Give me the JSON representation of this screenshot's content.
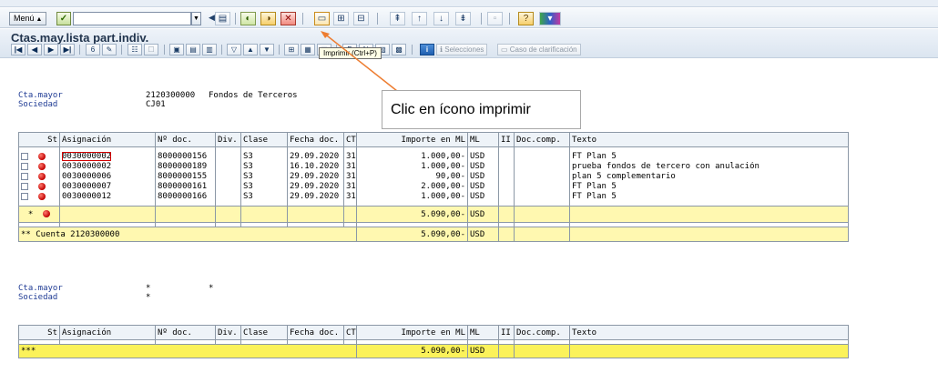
{
  "toolbar": {
    "menu_label": "Menú",
    "icons": [
      "back-icon",
      "exit-icon",
      "cancel-icon",
      "print-icon",
      "find-icon",
      "find-next-icon",
      "first-page-icon",
      "previous-page-icon",
      "next-page-icon",
      "last-page-icon",
      "new-session-icon",
      "help-icon",
      "layout-icon"
    ]
  },
  "title": "Ctas.may.lista part.indiv.",
  "app_toolbar": {
    "selecciones_label": "Selecciones",
    "caso_label": "Caso de clarificación"
  },
  "tooltip": "Imprimir (Ctrl+P)",
  "annotation": "Clic en ícono imprimir",
  "block1": {
    "cta_mayor_label": "Cta.mayor",
    "cta_mayor_value": "2120300000",
    "cta_mayor_text": "Fondos de Terceros",
    "sociedad_label": "Sociedad",
    "sociedad_value": "CJ01"
  },
  "table_headers": [
    "St",
    "Asignación",
    "Nº doc.",
    "Div.",
    "Clase",
    "Fecha doc.",
    "CT",
    "Importe en ML",
    "ML",
    "II",
    "Doc.comp.",
    "Texto"
  ],
  "rows": [
    {
      "asignacion": "0030000002",
      "nodoc": "8000000156",
      "div": "",
      "clase": "S3",
      "fecha": "29.09.2020",
      "ct": "31",
      "importe": "1.000,00-",
      "ml": "USD",
      "ii": "",
      "doccomp": "",
      "texto": "FT Plan 5"
    },
    {
      "asignacion": "0030000002",
      "nodoc": "8000000189",
      "div": "",
      "clase": "S3",
      "fecha": "16.10.2020",
      "ct": "31",
      "importe": "1.000,00-",
      "ml": "USD",
      "ii": "",
      "doccomp": "",
      "texto": "prueba fondos de tercero con anulación"
    },
    {
      "asignacion": "0030000006",
      "nodoc": "8000000155",
      "div": "",
      "clase": "S3",
      "fecha": "29.09.2020",
      "ct": "31",
      "importe": "90,00-",
      "ml": "USD",
      "ii": "",
      "doccomp": "",
      "texto": "plan 5 complementario"
    },
    {
      "asignacion": "0030000007",
      "nodoc": "8000000161",
      "div": "",
      "clase": "S3",
      "fecha": "29.09.2020",
      "ct": "31",
      "importe": "2.000,00-",
      "ml": "USD",
      "ii": "",
      "doccomp": "",
      "texto": "FT Plan 5"
    },
    {
      "asignacion": "0030000012",
      "nodoc": "8000000166",
      "div": "",
      "clase": "S3",
      "fecha": "29.09.2020",
      "ct": "31",
      "importe": "1.000,00-",
      "ml": "USD",
      "ii": "",
      "doccomp": "",
      "texto": "FT Plan 5"
    }
  ],
  "subtotal": {
    "marker": "*",
    "importe": "5.090,00-",
    "ml": "USD"
  },
  "cuenta_total": {
    "label": "** Cuenta 2120300000",
    "importe": "5.090,00-",
    "ml": "USD"
  },
  "block2": {
    "cta_mayor_label": "Cta.mayor",
    "cta_mayor_value": "*",
    "cta_mayor_text": "*",
    "sociedad_label": "Sociedad",
    "sociedad_value": "*"
  },
  "grand_total": {
    "label": "***",
    "importe": "5.090,00-",
    "ml": "USD"
  }
}
